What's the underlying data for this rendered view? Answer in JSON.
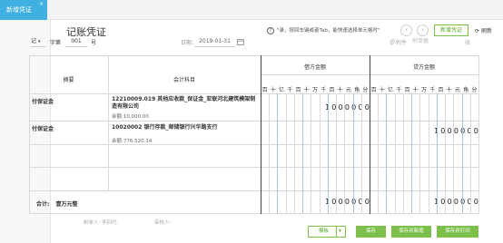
{
  "tabs": {
    "active_label": "新增凭证",
    "close_glyph": "×"
  },
  "header": {
    "title": "记账凭证",
    "hint_icon": "?",
    "hint_text": "\"录，按回车键或者Tab，能快速选择单元格时\"",
    "prev_glyph": "‹",
    "next_glyph": "›",
    "new_button": "新增凭证",
    "refresh_label": "刷新"
  },
  "fields": {
    "voucher_type": "记",
    "voucher_type_caret": "▾",
    "char_label": "字第",
    "voucher_no": "001",
    "no_label": "号",
    "date_label": "日期:",
    "date_value": "2019-01-31",
    "date_icon_name": "calendar-icon",
    "attach_label": "附件",
    "attach_placeholder": "附单据",
    "attach_unit": "张"
  },
  "table": {
    "col_summary": "摘要",
    "col_account": "会计科目",
    "col_debit": "借方金额",
    "col_credit": "贷方金额",
    "units": [
      "百",
      "十",
      "亿",
      "千",
      "百",
      "十",
      "万",
      "千",
      "百",
      "十",
      "元",
      "角",
      "分"
    ],
    "rows": [
      {
        "summary": "付保证金",
        "account": "12210009.019 其他应收款_保证金_亚联河北建筑模架制造有限公司",
        "balance": "余额:10,000.00",
        "debit": "1000000",
        "credit": ""
      },
      {
        "summary": "付保证金",
        "account": "10020002 银行存款_邮储银行兴华路支行",
        "balance": "余额:776,520.14",
        "debit": "",
        "credit": "1000000"
      }
    ],
    "total_label": "合计:",
    "total_text": "壹万元整",
    "total_debit": "1000000",
    "total_credit": "1000000"
  },
  "footer": {
    "maker_label": "制单人:",
    "maker_name": "李四代",
    "auditor_label": "审核人:",
    "template_button": "模板",
    "save_button": "保存",
    "save_new_button": "保存并新增",
    "save_print_button": "保存并打印"
  },
  "colors": {
    "accent_blue": "#3fb0e0",
    "accent_green": "#7cc04b"
  }
}
